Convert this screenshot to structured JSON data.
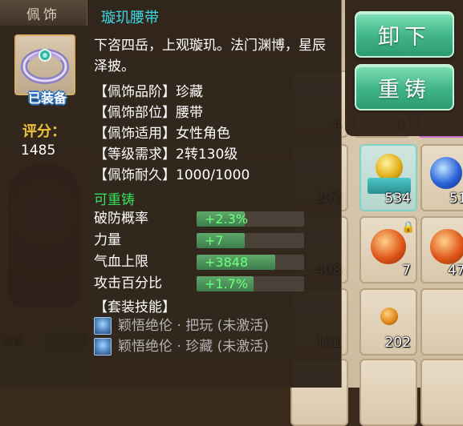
{
  "tab": {
    "label": "佩饰"
  },
  "item": {
    "name": "璇玑腰带",
    "equipped_badge": "已装备",
    "icon": "ring-belt-icon",
    "score_label": "评分：",
    "score_value": "1485",
    "description": "下咨四岳，上观璇玑。法门渊博，星辰泽披。",
    "attributes": [
      "【佩饰品阶】珍藏",
      "【佩饰部位】腰带",
      "【佩饰适用】女性角色",
      "【等级需求】2转130级",
      "【佩饰耐久】1000/1000"
    ],
    "reforge_label": "可重铸",
    "stats": [
      {
        "name": "破防概率",
        "value": "+2.3%",
        "progress": 0.45
      },
      {
        "name": "力量",
        "value": "+7",
        "progress": 0.45
      },
      {
        "name": "气血上限",
        "value": "+3848",
        "progress": 0.73
      },
      {
        "name": "攻击百分比",
        "value": "+1.7%",
        "progress": 0.53
      }
    ],
    "set_header": "【套装技能】",
    "set_skills": [
      {
        "text": "颖悟绝伦 · 把玩 (未激活)",
        "icon": "skill-icon"
      },
      {
        "text": "颖悟绝伦 · 珍藏 (未激活)",
        "icon": "skill-icon"
      }
    ]
  },
  "actions": {
    "unequip_label": "卸下",
    "reforge_label": "重铸"
  },
  "background": {
    "equip_label": "装备",
    "slot_counts": [
      "207",
      "534",
      "51",
      "408",
      "7",
      "47",
      "101",
      "202",
      "4",
      "8"
    ]
  },
  "colors": {
    "title_cyan": "#3bd9e6",
    "reforge_green": "#34e15a",
    "stat_value_green": "#6dff7f",
    "score_gold": "#f0c23a",
    "button_green": "#3fb487"
  }
}
